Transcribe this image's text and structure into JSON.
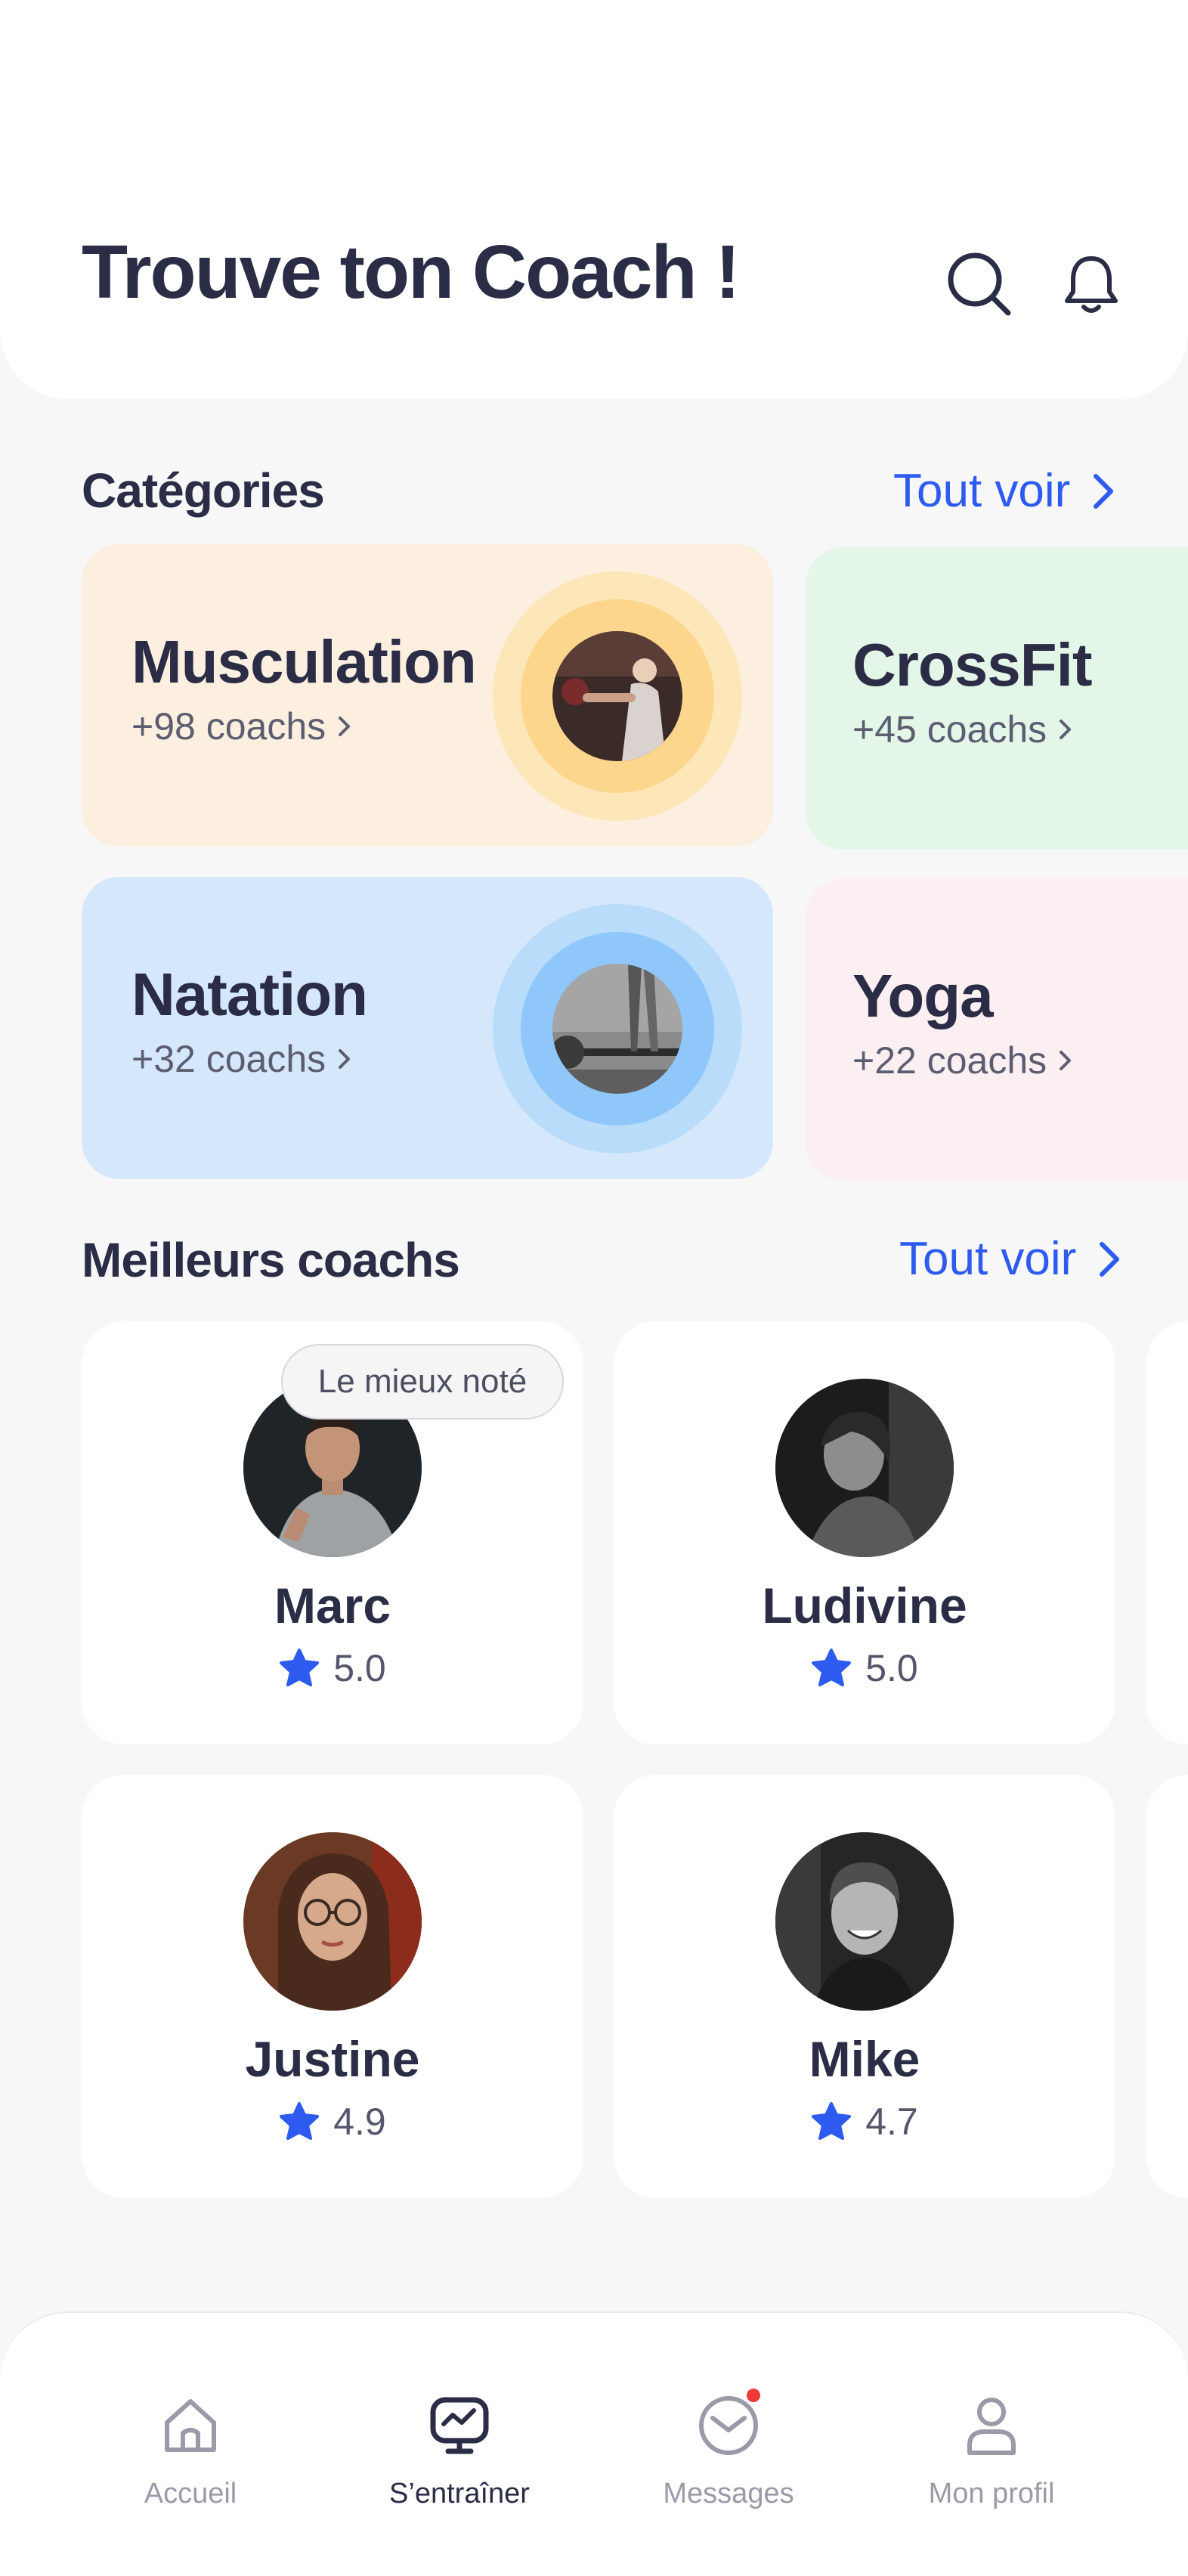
{
  "header": {
    "title": "Trouve ton Coach !"
  },
  "categories": {
    "title": "Catégories",
    "see_all": "Tout voir",
    "items": [
      {
        "name": "Musculation",
        "count": "+98 coachs",
        "bg": "#fcefe0",
        "ring_outer": "#fde6b8",
        "ring_inner": "#fcd68c"
      },
      {
        "name": "CrossFit",
        "count": "+45 coachs",
        "bg": "#e3f6e8"
      },
      {
        "name": "Natation",
        "count": "+32 coachs",
        "bg": "#d5e8fb",
        "ring_outer": "#b9dcfb",
        "ring_inner": "#8fc7fa"
      },
      {
        "name": "Yoga",
        "count": "+22 coachs",
        "bg": "#fbeff2"
      }
    ]
  },
  "coaches": {
    "title": "Meilleurs coachs",
    "see_all": "Tout voir",
    "badge": "Le mieux noté",
    "items": [
      {
        "name": "Marc",
        "rating": "5.0"
      },
      {
        "name": "Ludivine",
        "rating": "5.0"
      },
      {
        "name": "Justine",
        "rating": "4.9"
      },
      {
        "name": "Mike",
        "rating": "4.7"
      }
    ]
  },
  "nav": {
    "items": [
      {
        "label": "Accueil",
        "icon": "home-icon"
      },
      {
        "label": "S’entraîner",
        "icon": "training-icon"
      },
      {
        "label": "Messages",
        "icon": "mail-icon"
      },
      {
        "label": "Mon profil",
        "icon": "user-icon"
      }
    ]
  },
  "colors": {
    "accent": "#2d5bf0",
    "text": "#2b2c45",
    "notification": "#ef3a3a"
  }
}
